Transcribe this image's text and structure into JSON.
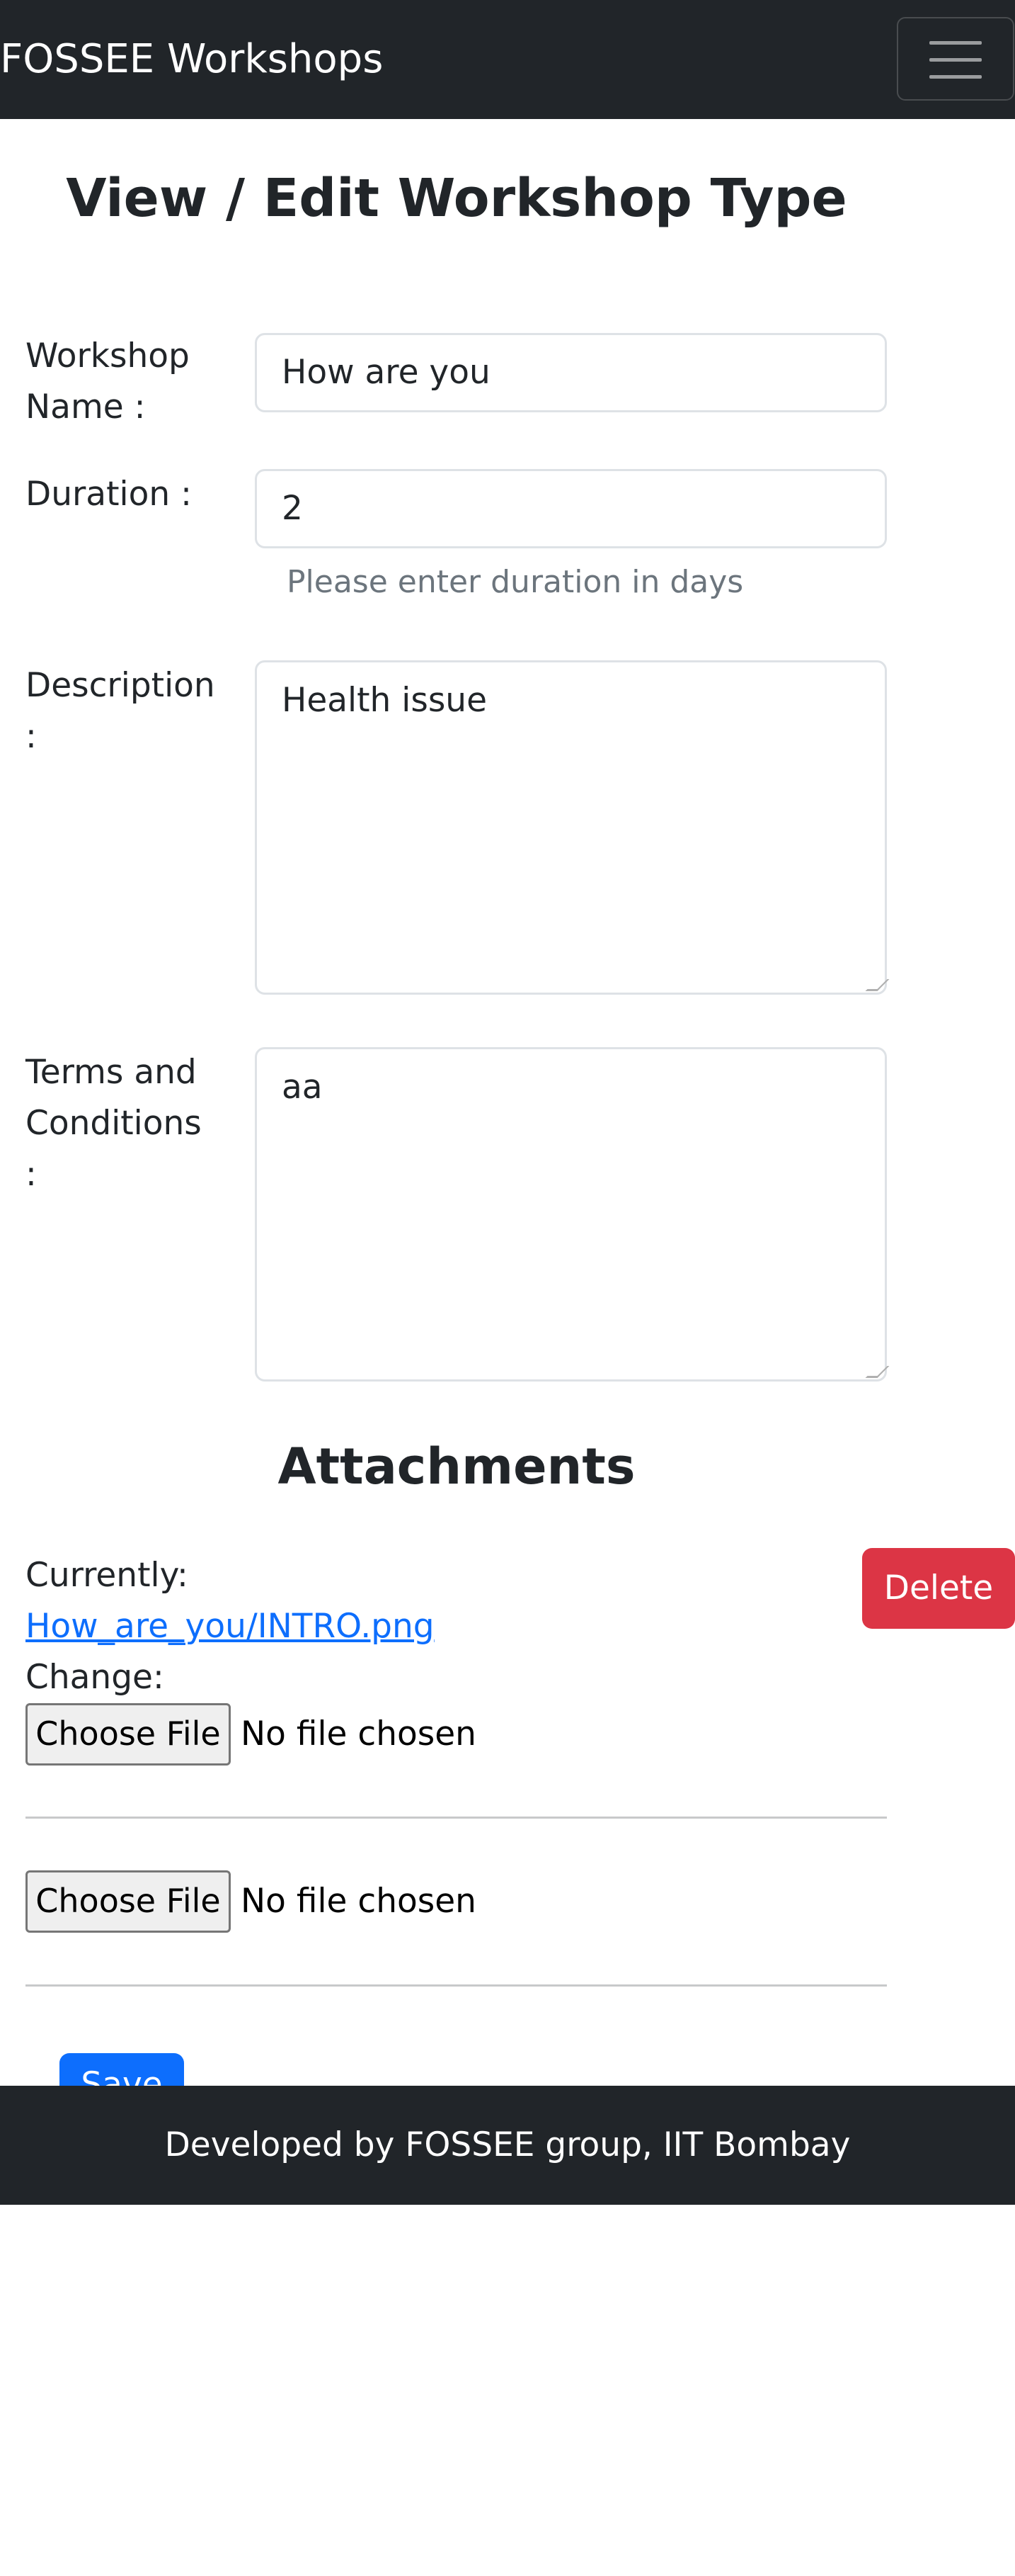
{
  "navbar": {
    "brand": "FOSSEE Workshops",
    "toggle_icon": "hamburger-menu-icon"
  },
  "page": {
    "title": "View / Edit Workshop Type"
  },
  "form": {
    "name_label_1": "Workshop",
    "name_label_2": "Name :",
    "name_value": "How are you",
    "duration_label": "Duration :",
    "duration_value": "2",
    "duration_help": "Please enter duration in days",
    "description_label_1": "Description",
    "description_label_2": ":",
    "description_value": "Health issue",
    "terms_label_1": "Terms and",
    "terms_label_2": "Conditions",
    "terms_label_3": ":",
    "terms_value": "aa"
  },
  "attachments": {
    "title": "Attachments",
    "currently_label": "Currently:",
    "current_file": "How_are_you/INTRO.png",
    "change_label": "Change:",
    "delete_label": "Delete",
    "choose_file_label": "Choose File",
    "no_file_text": "No file chosen"
  },
  "save": {
    "label": "Save"
  },
  "footer": {
    "text": "Developed by FOSSEE group, IIT Bombay"
  },
  "colors": {
    "navbar_bg": "#212529",
    "primary": "#0d6efd",
    "danger": "#dc3545",
    "muted_text": "#6c757d"
  }
}
